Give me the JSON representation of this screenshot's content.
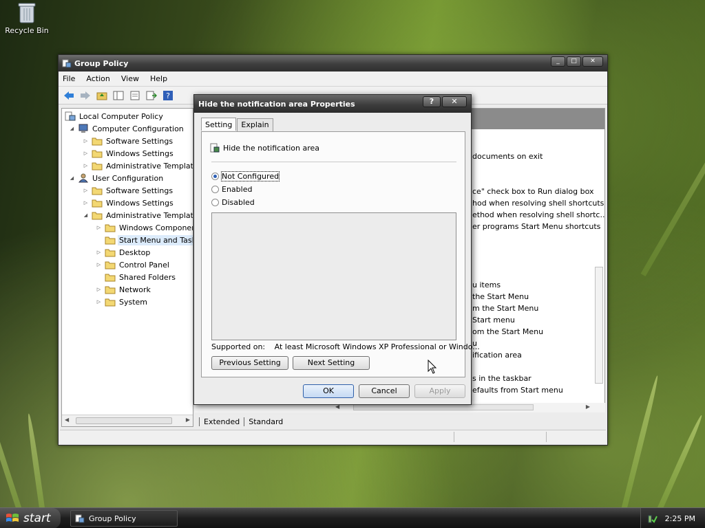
{
  "desktop": {
    "recycle_bin": "Recycle Bin"
  },
  "window": {
    "title": "Group Policy",
    "controls": {
      "minimize": "_",
      "maximize": "□",
      "close": "✕"
    },
    "menu": [
      "File",
      "Action",
      "View",
      "Help"
    ]
  },
  "tree": {
    "items": [
      {
        "label": "Local Computer Policy"
      },
      {
        "label": "Computer Configuration"
      },
      {
        "label": "Software Settings"
      },
      {
        "label": "Windows Settings"
      },
      {
        "label": "Administrative Templates"
      },
      {
        "label": "User Configuration"
      },
      {
        "label": "Software Settings"
      },
      {
        "label": "Windows Settings"
      },
      {
        "label": "Administrative Templates"
      },
      {
        "label": "Windows Components"
      },
      {
        "label": "Start Menu and Taskbar"
      },
      {
        "label": "Desktop"
      },
      {
        "label": "Control Panel"
      },
      {
        "label": "Shared Folders"
      },
      {
        "label": "Network"
      },
      {
        "label": "System"
      }
    ]
  },
  "right_pane": {
    "items": [
      "documents on exit",
      "ce\" check box to Run dialog box",
      "hod when resolving shell shortcuts",
      "ethod when resolving shell shortc...",
      "er programs Start Menu shortcuts",
      "u items",
      "the Start Menu",
      "m the Start Menu",
      "Start menu",
      "om the Start Menu",
      "u",
      "ification area",
      "s in the taskbar",
      "efaults from Start menu"
    ],
    "tabs": [
      "Extended",
      "Standard"
    ]
  },
  "dialog": {
    "title": "Hide the notification area Properties",
    "help_btn": "?",
    "close_btn": "✕",
    "tabs": [
      "Setting",
      "Explain"
    ],
    "policy_name": "Hide the notification area",
    "options": [
      "Not Configured",
      "Enabled",
      "Disabled"
    ],
    "selected_option": "Not Configured",
    "supported_label": "Supported on:",
    "supported_value": "At least Microsoft Windows XP Professional or Windo...",
    "prev_btn": "Previous Setting",
    "next_btn": "Next Setting",
    "ok_btn": "OK",
    "cancel_btn": "Cancel",
    "apply_btn": "Apply"
  },
  "taskbar": {
    "start_label": "start",
    "task_item": "Group Policy",
    "clock": "2:25 PM"
  }
}
